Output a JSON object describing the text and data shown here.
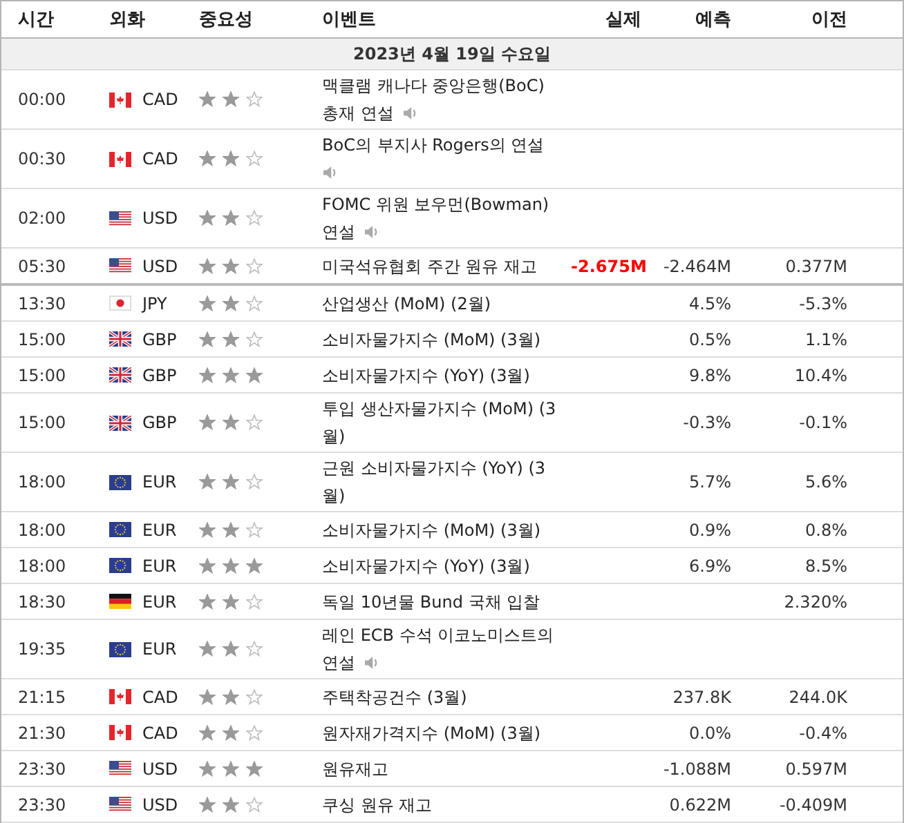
{
  "columns": [
    "시간",
    "외화",
    "중요성",
    "이벤트",
    "실제",
    "예측",
    "이전"
  ],
  "date": "2023년 4월 19일 수요일",
  "rows": [
    {
      "time": "00:00",
      "kind": "ca",
      "currency": "CAD",
      "stars": 2,
      "event": "맥클램 캐나다 중앙은행(BoC) 총재 연설",
      "audio": true,
      "actual": "",
      "forecast": "",
      "previous": "",
      "divider_below": false
    },
    {
      "time": "00:30",
      "kind": "ca",
      "currency": "CAD",
      "stars": 2,
      "event": "BoC의 부지사 Rogers의 연설",
      "audio": true,
      "actual": "",
      "forecast": "",
      "previous": "",
      "divider_below": false
    },
    {
      "time": "02:00",
      "kind": "us",
      "currency": "USD",
      "stars": 2,
      "event": "FOMC 위원 보우먼(Bowman) 연설",
      "audio": true,
      "actual": "",
      "forecast": "",
      "previous": "",
      "divider_below": false
    },
    {
      "time": "05:30",
      "kind": "us",
      "currency": "USD",
      "stars": 2,
      "event": "미국석유협회 주간 원유 재고",
      "audio": false,
      "actual": "-2.675M",
      "color": "#ff0000",
      "forecast": "-2.464M",
      "previous": "0.377M",
      "divider_below": true
    },
    {
      "time": "13:30",
      "kind": "jp",
      "currency": "JPY",
      "stars": 2,
      "event": "산업생산 (MoM) (2월)",
      "audio": false,
      "actual": "",
      "forecast": "4.5%",
      "previous": "-5.3%",
      "divider_below": false
    },
    {
      "time": "15:00",
      "kind": "gb",
      "currency": "GBP",
      "stars": 2,
      "event": "소비자물가지수 (MoM) (3월)",
      "audio": false,
      "actual": "",
      "forecast": "0.5%",
      "previous": "1.1%",
      "divider_below": false
    },
    {
      "time": "15:00",
      "kind": "gb",
      "currency": "GBP",
      "stars": 3,
      "event": "소비자물가지수 (YoY) (3월)",
      "audio": false,
      "actual": "",
      "forecast": "9.8%",
      "previous": "10.4%",
      "divider_below": false
    },
    {
      "time": "15:00",
      "kind": "gb",
      "currency": "GBP",
      "stars": 2,
      "event": "투입 생산자물가지수 (MoM) (3월)",
      "audio": false,
      "actual": "",
      "forecast": "-0.3%",
      "previous": "-0.1%",
      "divider_below": false
    },
    {
      "time": "18:00",
      "kind": "eu",
      "currency": "EUR",
      "stars": 2,
      "event": "근원 소비자물가지수 (YoY) (3월)",
      "audio": false,
      "actual": "",
      "forecast": "5.7%",
      "previous": "5.6%",
      "divider_below": false
    },
    {
      "time": "18:00",
      "kind": "eu",
      "currency": "EUR",
      "stars": 2,
      "event": "소비자물가지수 (MoM) (3월)",
      "audio": false,
      "actual": "",
      "forecast": "0.9%",
      "previous": "0.8%",
      "divider_below": false
    },
    {
      "time": "18:00",
      "kind": "eu",
      "currency": "EUR",
      "stars": 3,
      "event": "소비자물가지수 (YoY) (3월)",
      "audio": false,
      "actual": "",
      "forecast": "6.9%",
      "previous": "8.5%",
      "divider_below": false
    },
    {
      "time": "18:30",
      "kind": "de",
      "currency": "EUR",
      "stars": 2,
      "event": "독일 10년물 Bund 국채 입찰",
      "audio": false,
      "actual": "",
      "forecast": "",
      "previous": "2.320%",
      "divider_below": false
    },
    {
      "time": "19:35",
      "kind": "eu",
      "currency": "EUR",
      "stars": 2,
      "event": "레인 ECB 수석 이코노미스트의 연설",
      "audio": true,
      "actual": "",
      "forecast": "",
      "previous": "",
      "divider_below": false
    },
    {
      "time": "21:15",
      "kind": "ca",
      "currency": "CAD",
      "stars": 2,
      "event": "주택착공건수 (3월)",
      "audio": false,
      "actual": "",
      "forecast": "237.8K",
      "previous": "244.0K",
      "divider_below": false
    },
    {
      "time": "21:30",
      "kind": "ca",
      "currency": "CAD",
      "stars": 2,
      "event": "원자재가격지수 (MoM) (3월)",
      "audio": false,
      "actual": "",
      "forecast": "0.0%",
      "previous": "-0.4%",
      "divider_below": false
    },
    {
      "time": "23:30",
      "kind": "us",
      "currency": "USD",
      "stars": 3,
      "event": "원유재고",
      "audio": false,
      "actual": "",
      "forecast": "-1.088M",
      "previous": "0.597M",
      "divider_below": false
    },
    {
      "time": "23:30",
      "kind": "us",
      "currency": "USD",
      "stars": 2,
      "event": "쿠싱 원유 재고",
      "audio": false,
      "actual": "",
      "forecast": "0.622M",
      "previous": "-0.409M",
      "divider_below": false
    }
  ]
}
